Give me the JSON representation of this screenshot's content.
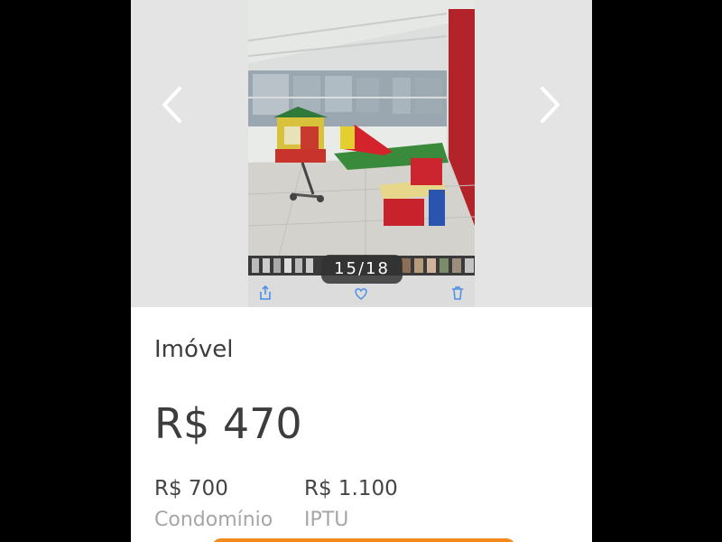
{
  "gallery": {
    "counter": "15/18",
    "prev_icon": "chevron-left-icon",
    "next_icon": "chevron-right-icon",
    "toolbar_icons": [
      "share-icon",
      "heart-icon",
      "trash-icon"
    ]
  },
  "listing": {
    "title": "Imóvel",
    "price": "R$ 470",
    "condo_value": "R$ 700",
    "condo_label": "Condomínio",
    "iptu_value": "R$ 1.100",
    "iptu_label": "IPTU"
  },
  "colors": {
    "accent": "#f28a1e",
    "ios_blue": "#4a8fe8"
  }
}
